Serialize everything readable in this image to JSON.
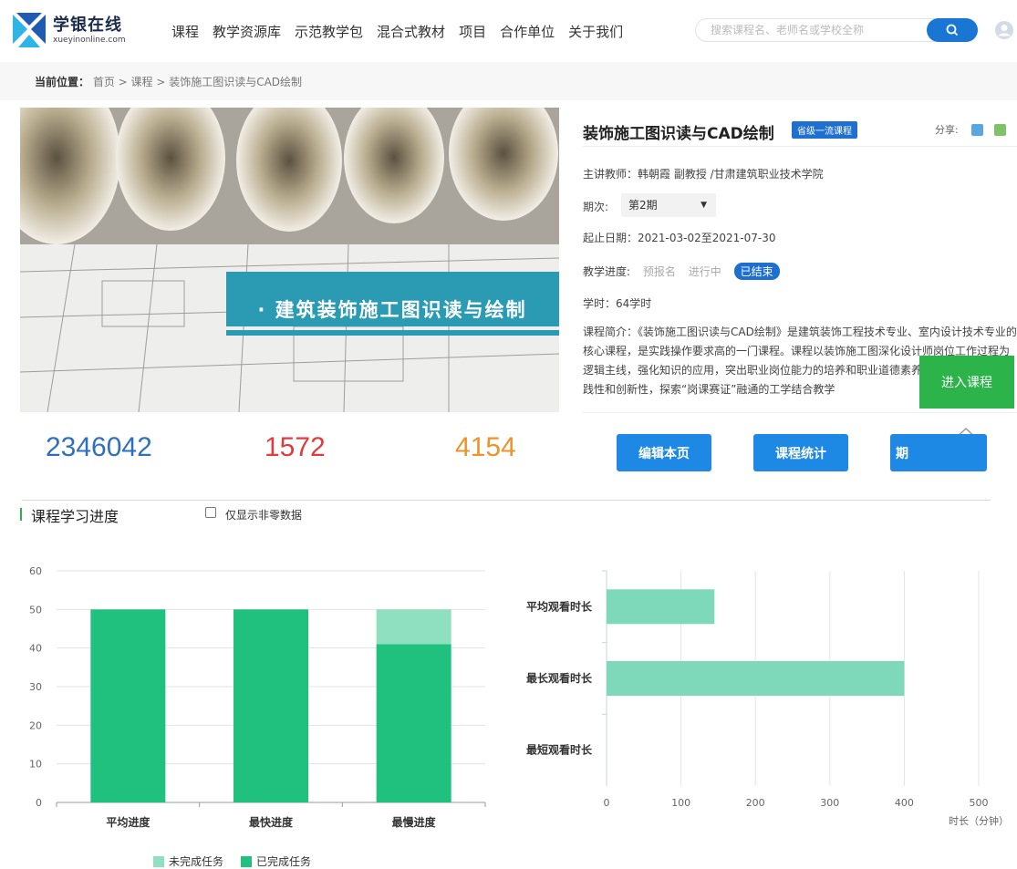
{
  "header": {
    "logo_name": "学银在线",
    "logo_sub": "xueyinonline.com",
    "nav": [
      "课程",
      "教学资源库",
      "示范教学包",
      "混合式教材",
      "项目",
      "合作单位",
      "关于我们"
    ],
    "search_placeholder": "搜索课程名、老师名或学校全称",
    "search_icon": "search-icon",
    "user_icon": "user-avatar-icon"
  },
  "breadcrumb": {
    "label": "当前位置：",
    "path": "首页 > 课程 > 装饰施工图识读与CAD绘制"
  },
  "banner": {
    "title": "· 建筑装饰施工图识读与绘制"
  },
  "course": {
    "title": "装饰施工图识读与CAD绘制",
    "badge": "省级一流课程",
    "share_label": "分享:",
    "teacher": "主讲教师：韩朝霞 副教授 /甘肃建筑职业技术学院",
    "term_label": "期次:",
    "term_value": "第2期",
    "dates": "起止日期：2021-03-02至2021-07-30",
    "progress_label": "教学进度:",
    "progress_steps": [
      "预报名",
      "进行中",
      "已结束"
    ],
    "hours": "学时：64学时",
    "description": "课程简介：《装饰施工图识读与CAD绘制》是建筑装饰工程技术专业、室内设计技术专业的核心课程，是实践操作要求高的一门课程。课程以装饰施工图深化设计师岗位工作过程为逻辑主线，强化知识的应用，突出职业岗位能力的培养和职业道德素养，凸显应用性、实践性和创新性，探索“岗课赛证”融通的工学结合教学"
  },
  "stats": [
    {
      "value": "2346042",
      "color": "#2f6fbf"
    },
    {
      "value": "1572",
      "color": "#e23b3b"
    },
    {
      "value": "4154",
      "color": "#f0922b"
    }
  ],
  "actions": [
    "编辑本页",
    "课程统计",
    "期"
  ],
  "enter_button": "进入课程",
  "section": {
    "title": "课程学习进度",
    "checkbox_label": "仅显示非零数据"
  },
  "chart_data": [
    {
      "type": "bar",
      "stacked": true,
      "categories": [
        "平均进度",
        "最快进度",
        "最慢进度"
      ],
      "series": [
        {
          "name": "已完成任务",
          "color": "#20c07f",
          "values": [
            50,
            50,
            41
          ]
        },
        {
          "name": "未完成任务",
          "color": "#8fe0c1",
          "values": [
            0,
            0,
            9
          ]
        }
      ],
      "ylim": [
        0,
        60
      ],
      "yticks": [
        0,
        10,
        20,
        30,
        40,
        50,
        60
      ],
      "grid": true,
      "legend": "bottom-left"
    },
    {
      "type": "bar",
      "orientation": "horizontal",
      "categories": [
        "平均观看时长",
        "最长观看时长",
        "最短观看时长"
      ],
      "values": [
        145,
        400,
        0
      ],
      "color": "#7dd9b9",
      "xlim": [
        0,
        500
      ],
      "xticks": [
        0,
        100,
        200,
        300,
        400,
        500
      ],
      "xlabel": "时长（分钟）",
      "grid": true
    }
  ]
}
